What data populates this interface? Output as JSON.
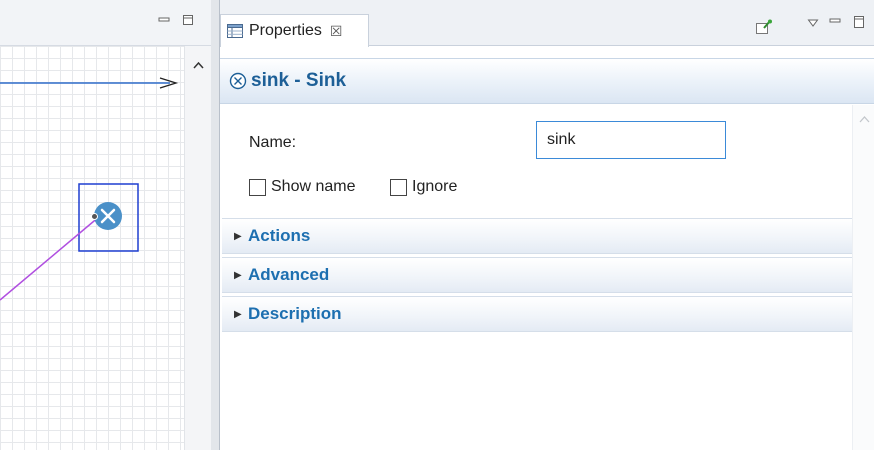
{
  "properties_tab": {
    "label": "Properties",
    "close_glyph": "☒"
  },
  "panel": {
    "title": "sink - Sink",
    "title_icon": "sink-icon"
  },
  "form": {
    "name_label": "Name:",
    "name_value": "sink",
    "show_name_label": "Show name",
    "show_name_checked": false,
    "ignore_label": "Ignore",
    "ignore_checked": false
  },
  "sections": [
    {
      "label": "Actions",
      "expanded": false
    },
    {
      "label": "Advanced",
      "expanded": false
    },
    {
      "label": "Description",
      "expanded": false
    }
  ],
  "colors": {
    "accent_blue": "#1d6fb0",
    "title_blue": "#1d5f97",
    "sink_fill": "#4a90c8",
    "selection_blue": "#1f3fd1",
    "connector_purple": "#b04fe0",
    "flow_line_blue": "#2f6cc9"
  }
}
